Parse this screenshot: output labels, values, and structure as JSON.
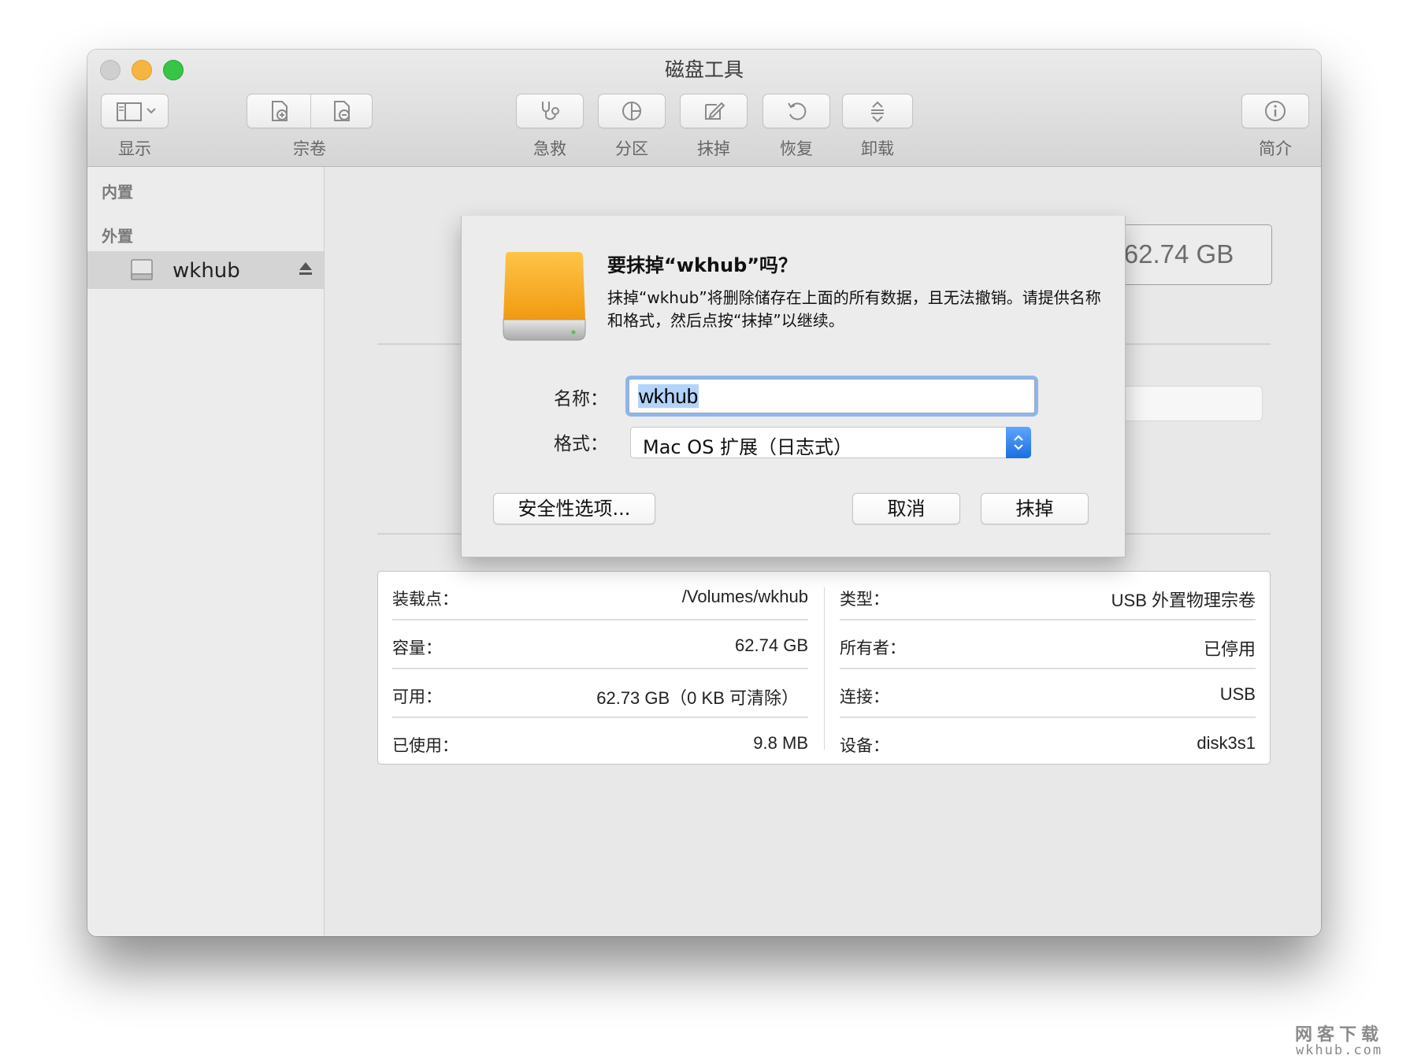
{
  "window": {
    "title": "磁盘工具"
  },
  "toolbar": {
    "view_label": "显示",
    "volume_label": "宗卷",
    "firstaid_label": "急救",
    "partition_label": "分区",
    "erase_label": "抹掉",
    "restore_label": "恢复",
    "unmount_label": "卸载",
    "info_label": "简介"
  },
  "sidebar": {
    "internal_header": "内置",
    "external_header": "外置",
    "items": [
      {
        "label": "wkhub"
      }
    ]
  },
  "main": {
    "capacity_display": "62.74 GB",
    "info_left": [
      {
        "key": "装载点：",
        "value": "/Volumes/wkhub"
      },
      {
        "key": "容量：",
        "value": "62.74 GB"
      },
      {
        "key": "可用：",
        "value": "62.73 GB（0 KB 可清除）"
      },
      {
        "key": "已使用：",
        "value": "9.8 MB"
      }
    ],
    "info_right": [
      {
        "key": "类型：",
        "value": "USB 外置物理宗卷"
      },
      {
        "key": "所有者：",
        "value": "已停用"
      },
      {
        "key": "连接：",
        "value": "USB"
      },
      {
        "key": "设备：",
        "value": "disk3s1"
      }
    ]
  },
  "dialog": {
    "title": "要抹掉“wkhub”吗？",
    "message": "抹掉“wkhub”将删除储存在上面的所有数据，且无法撤销。请提供名称和格式，然后点按“抹掉”以继续。",
    "name_label": "名称：",
    "name_value": "wkhub",
    "format_label": "格式：",
    "format_value": "Mac OS 扩展（日志式）",
    "security_button": "安全性选项...",
    "cancel_button": "取消",
    "erase_button": "抹掉"
  },
  "watermark": {
    "line1": "网客下载",
    "line2": "wkhub.com"
  },
  "colors": {
    "accent": "#1a6fe0",
    "selection": "#b2d4fb",
    "focus_ring": "#8fb5ec"
  }
}
